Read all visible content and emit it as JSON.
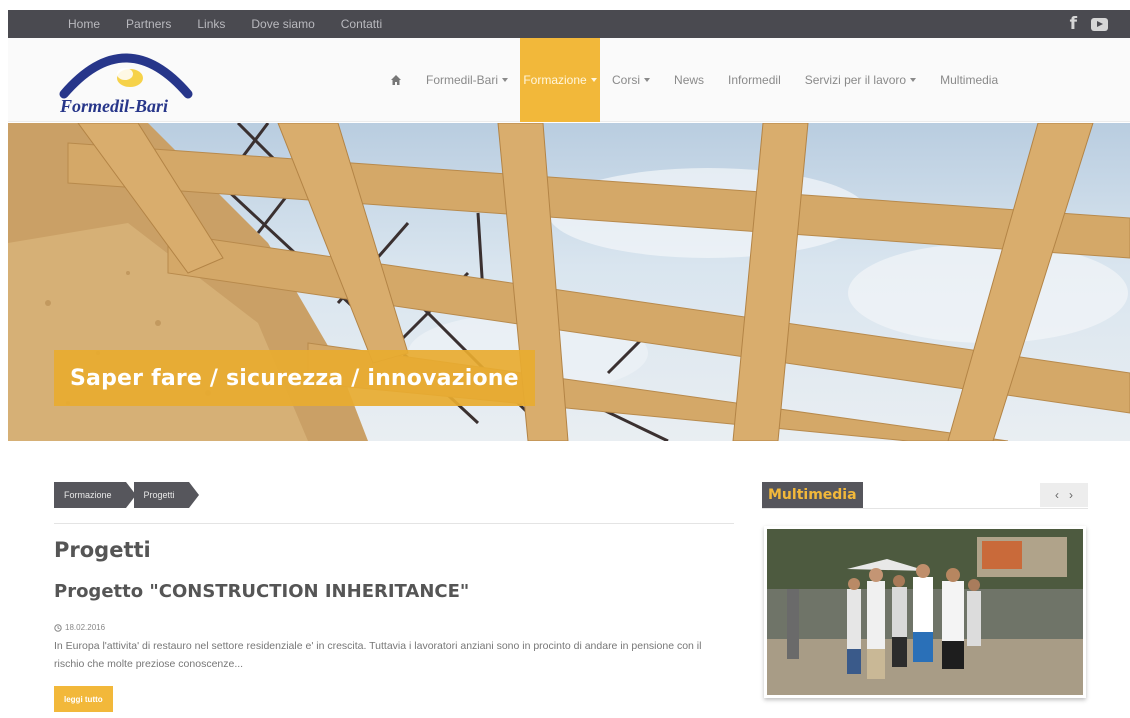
{
  "topbar": {
    "links": [
      "Home",
      "Partners",
      "Links",
      "Dove siamo",
      "Contatti"
    ],
    "social": [
      "facebook-icon",
      "youtube-icon"
    ]
  },
  "header": {
    "logo_text": "Formedil-Bari",
    "nav": [
      {
        "label": "Formedil-Bari",
        "dropdown": true
      },
      {
        "label": "Formazione",
        "dropdown": true,
        "active": true
      },
      {
        "label": "Corsi",
        "dropdown": true
      },
      {
        "label": "News",
        "dropdown": false
      },
      {
        "label": "Informedil",
        "dropdown": false
      },
      {
        "label": "Servizi per il lavoro",
        "dropdown": true
      },
      {
        "label": "Multimedia",
        "dropdown": false
      }
    ]
  },
  "hero": {
    "caption": "Saper fare / sicurezza / innovazione"
  },
  "breadcrumb": [
    "Formazione",
    "Progetti"
  ],
  "page_title": "Progetti",
  "article": {
    "title": "Progetto \"CONSTRUCTION INHERITANCE\"",
    "date": "18.02.2016",
    "excerpt": "In Europa l'attivita' di restauro nel settore residenziale e' in crescita. Tuttavia i lavoratori anziani sono in procinto di andare in pensione con il rischio che molte preziose conoscenze...",
    "read_more": "leggi tutto"
  },
  "sidebar": {
    "title": "Multimedia",
    "prev": "‹",
    "next": "›"
  },
  "colors": {
    "accent": "#f2b83a",
    "dark": "#4a4a50",
    "logo_blue": "#27368a"
  }
}
